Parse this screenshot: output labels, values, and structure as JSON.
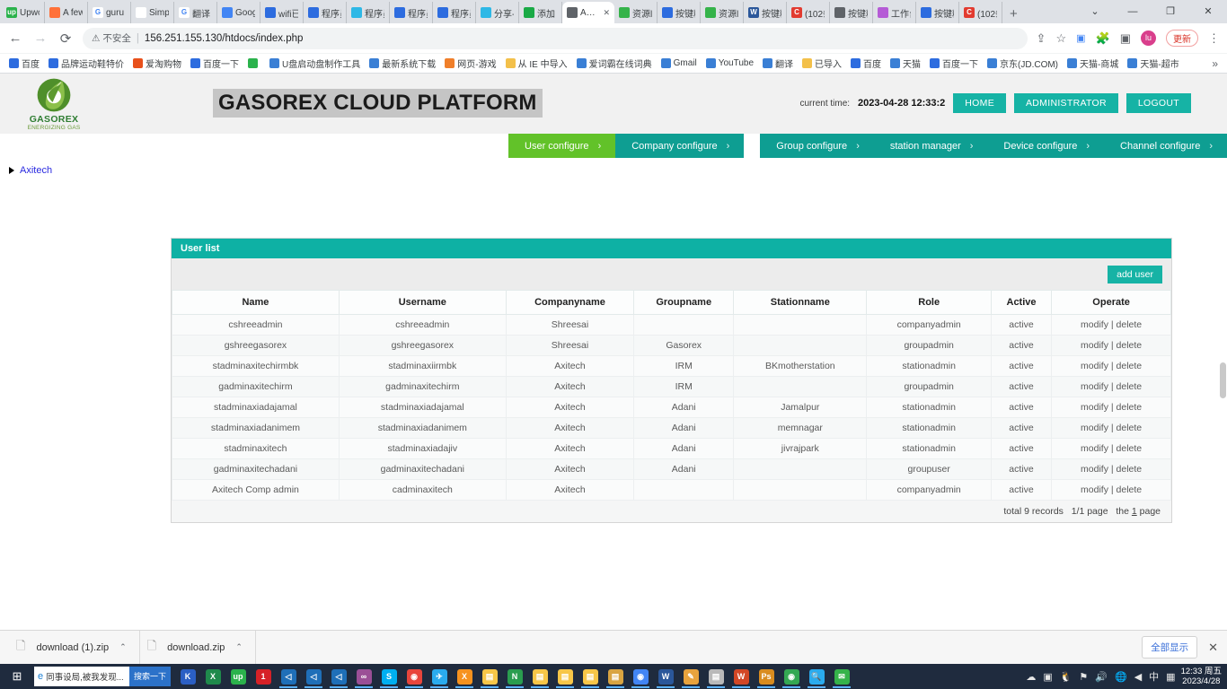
{
  "browser": {
    "tabs": [
      {
        "label": "Upwo",
        "icon": "up-icon",
        "color": "#2bb24c",
        "active": false
      },
      {
        "label": "A few",
        "icon": "firefox-icon",
        "color": "#ff7139",
        "active": false
      },
      {
        "label": "guru",
        "icon": "google-g-icon",
        "color": "#ffffff",
        "active": false
      },
      {
        "label": "Simp",
        "icon": "scissors-icon",
        "color": "#ffffff",
        "active": false
      },
      {
        "label": "翻译",
        "icon": "google-g-icon",
        "color": "#ffffff",
        "active": false
      },
      {
        "label": "Goog",
        "icon": "translate-icon",
        "color": "#4285f4",
        "active": false
      },
      {
        "label": "wifi已",
        "icon": "baidu-icon",
        "color": "#2d6cdf",
        "active": false
      },
      {
        "label": "程序员",
        "icon": "baidu-icon",
        "color": "#2d6cdf",
        "active": false
      },
      {
        "label": "程序员",
        "icon": "calendar-icon",
        "color": "#2eb8e6",
        "active": false
      },
      {
        "label": "程序员",
        "icon": "baidu-icon",
        "color": "#2d6cdf",
        "active": false
      },
      {
        "label": "程序员",
        "icon": "baidu-icon",
        "color": "#2d6cdf",
        "active": false
      },
      {
        "label": "分享-",
        "icon": "calendar-icon",
        "color": "#2eb8e6",
        "active": false
      },
      {
        "label": "添加",
        "icon": "youdao-icon",
        "color": "#1aaa46",
        "active": false
      },
      {
        "label": "A…",
        "icon": "globe-icon",
        "color": "#5f6368",
        "active": true
      },
      {
        "label": "资源l",
        "icon": "resource-icon",
        "color": "#35b34a",
        "active": false
      },
      {
        "label": "按键精",
        "icon": "baidu-icon",
        "color": "#2d6cdf",
        "active": false
      },
      {
        "label": "资源l",
        "icon": "resource-icon",
        "color": "#35b34a",
        "active": false
      },
      {
        "label": "按键精",
        "icon": "word-icon",
        "color": "#2b579a",
        "active": false
      },
      {
        "label": "(102条",
        "icon": "csdn-icon",
        "color": "#e23b30",
        "active": false
      },
      {
        "label": "按键精",
        "icon": "globe-icon",
        "color": "#5f6368",
        "active": false
      },
      {
        "label": "工作台",
        "icon": "feishu-icon",
        "color": "#b55bd6",
        "active": false
      },
      {
        "label": "按键精",
        "icon": "baidu-icon",
        "color": "#2d6cdf",
        "active": false
      },
      {
        "label": "(102条",
        "icon": "csdn-icon",
        "color": "#e23b30",
        "active": false
      }
    ],
    "new_tab_label": "+",
    "window_controls": {
      "minimize": "—",
      "maximize": "❐",
      "close": "✕",
      "expand": "⌄"
    },
    "nav": {
      "back": "←",
      "forward": "→",
      "reload": "⟳"
    },
    "omnibox": {
      "security_icon": "warning-triangle-icon",
      "security_label": "不安全",
      "url": "156.251.155.130/htdocs/index.php"
    },
    "toolbar_icons": [
      {
        "name": "translate-icon",
        "glyph": "文"
      },
      {
        "name": "extensions-puzzle-icon",
        "glyph": "🧩"
      },
      {
        "name": "sidepanel-icon",
        "glyph": "▣"
      }
    ],
    "profile_initial": "lu",
    "update_label": "更新",
    "menu_glyph": "⋮",
    "share_glyph": "⇪",
    "star_glyph": "☆",
    "bookmarks": [
      {
        "label": "百度",
        "icon": "baidu-icon",
        "color": "#2d6cdf"
      },
      {
        "label": "品牌运动鞋特价",
        "icon": "baidu-icon",
        "color": "#2d6cdf"
      },
      {
        "label": "爱淘购物",
        "icon": "taobao-icon",
        "color": "#e8501b"
      },
      {
        "label": "百度一下",
        "icon": "baidu-icon",
        "color": "#2d6cdf"
      },
      {
        "label": "",
        "icon": "up-icon",
        "color": "#2bb24c"
      },
      {
        "label": "U盘启动盘制作工具",
        "icon": "globe-icon",
        "color": "#3a7fd5"
      },
      {
        "label": "最新系统下载",
        "icon": "globe-icon",
        "color": "#3a7fd5"
      },
      {
        "label": "网页-游戏",
        "icon": "opera-icon",
        "color": "#f07f2a"
      },
      {
        "label": "从 IE 中导入",
        "icon": "folder-icon",
        "color": "#f3c04a"
      },
      {
        "label": "爱词霸在线词典",
        "icon": "globe-icon",
        "color": "#3a7fd5"
      },
      {
        "label": "Gmail",
        "icon": "globe-icon",
        "color": "#3a7fd5"
      },
      {
        "label": "YouTube",
        "icon": "globe-icon",
        "color": "#3a7fd5"
      },
      {
        "label": "翻译",
        "icon": "globe-icon",
        "color": "#3a7fd5"
      },
      {
        "label": "已导入",
        "icon": "folder-icon",
        "color": "#f3c04a"
      },
      {
        "label": "百度",
        "icon": "baidu-icon",
        "color": "#2d6cdf"
      },
      {
        "label": "天猫",
        "icon": "globe-icon",
        "color": "#3a7fd5"
      },
      {
        "label": "百度一下",
        "icon": "baidu-icon",
        "color": "#2d6cdf"
      },
      {
        "label": "京东(JD.COM)",
        "icon": "globe-icon",
        "color": "#3a7fd5"
      },
      {
        "label": "天猫-商城",
        "icon": "globe-icon",
        "color": "#3a7fd5"
      },
      {
        "label": "天猫-超市",
        "icon": "globe-icon",
        "color": "#3a7fd5"
      }
    ],
    "bookmarks_overflow": "»"
  },
  "site": {
    "logo": {
      "name": "GASOREX",
      "tagline": "ENERGIZING GAS",
      "accent": "#4a8a2c"
    },
    "title": "GASOREX CLOUD PLATFORM",
    "translate_badge": "G",
    "time_label": "current time:",
    "time_value": "2023-04-28 12:33:2",
    "buttons": [
      {
        "label": "HOME",
        "name": "home-button"
      },
      {
        "label": "ADMINISTRATOR",
        "name": "administrator-button"
      },
      {
        "label": "LOGOUT",
        "name": "logout-button"
      }
    ],
    "accent": "#16b3a5",
    "nav": [
      {
        "label": "User configure",
        "active": true,
        "chevron": "›"
      },
      {
        "label": "Company configure",
        "active": false,
        "chevron": "›"
      },
      {
        "label": "Group configure",
        "active": false,
        "chevron": "›"
      },
      {
        "label": "station manager",
        "active": false,
        "chevron": "›"
      },
      {
        "label": "Device configure",
        "active": false,
        "chevron": "›"
      },
      {
        "label": "Channel configure",
        "active": false,
        "chevron": "›"
      }
    ]
  },
  "sidebar": {
    "tree": [
      {
        "label": "Axitech",
        "arrow": "▶"
      }
    ]
  },
  "panel": {
    "title": "User list",
    "add_button": "add user",
    "columns": [
      "Name",
      "Username",
      "Companyname",
      "Groupname",
      "Stationname",
      "Role",
      "Active",
      "Operate"
    ],
    "rows": [
      {
        "name": "cshreeadmin",
        "username": "cshreeadmin",
        "company": "Shreesai",
        "group": "",
        "station": "",
        "role": "companyadmin",
        "active": "active",
        "operate": "modify | delete"
      },
      {
        "name": "gshreegasorex",
        "username": "gshreegasorex",
        "company": "Shreesai",
        "group": "Gasorex",
        "station": "",
        "role": "groupadmin",
        "active": "active",
        "operate": "modify | delete"
      },
      {
        "name": "stadminaxitechirmbk",
        "username": "stadminaxiirmbk",
        "company": "Axitech",
        "group": "IRM",
        "station": "BKmotherstation",
        "role": "stationadmin",
        "active": "active",
        "operate": "modify | delete"
      },
      {
        "name": "gadminaxitechirm",
        "username": "gadminaxitechirm",
        "company": "Axitech",
        "group": "IRM",
        "station": "",
        "role": "groupadmin",
        "active": "active",
        "operate": "modify | delete"
      },
      {
        "name": "stadminaxiadajamal",
        "username": "stadminaxiadajamal",
        "company": "Axitech",
        "group": "Adani",
        "station": "Jamalpur",
        "role": "stationadmin",
        "active": "active",
        "operate": "modify | delete"
      },
      {
        "name": "stadminaxiadanimem",
        "username": "stadminaxiadanimem",
        "company": "Axitech",
        "group": "Adani",
        "station": "memnagar",
        "role": "stationadmin",
        "active": "active",
        "operate": "modify | delete"
      },
      {
        "name": "stadminaxitech",
        "username": "stadminaxiadajiv",
        "company": "Axitech",
        "group": "Adani",
        "station": "jivrajpark",
        "role": "stationadmin",
        "active": "active",
        "operate": "modify | delete"
      },
      {
        "name": "gadminaxitechadani",
        "username": "gadminaxitechadani",
        "company": "Axitech",
        "group": "Adani",
        "station": "",
        "role": "groupuser",
        "active": "active",
        "operate": "modify | delete"
      },
      {
        "name": "Axitech Comp admin",
        "username": "cadminaxitech",
        "company": "Axitech",
        "group": "",
        "station": "",
        "role": "companyadmin",
        "active": "active",
        "operate": "modify | delete"
      }
    ],
    "footer": {
      "total_label": "total",
      "total_count": "9",
      "records_label": "records",
      "page_of": "1/1 page",
      "the_label": "the",
      "current_page": "1",
      "page_label": "page"
    }
  },
  "downloads": {
    "items": [
      {
        "filename": "download (1).zip",
        "caret": "⌃"
      },
      {
        "filename": "download.zip",
        "caret": "⌃"
      }
    ],
    "show_all": "全部显示",
    "close": "✕"
  },
  "taskbar": {
    "start_glyph": "⊞",
    "search_text": "同事设局,被我发现...",
    "search_button": "搜索一下",
    "apps": [
      {
        "name": "wps-icon",
        "glyph": "K",
        "color": "#2b5fc4",
        "open": false
      },
      {
        "name": "excel-icon",
        "glyph": "X",
        "color": "#1f8a4c",
        "open": false
      },
      {
        "name": "upwork-icon",
        "glyph": "up",
        "color": "#2bb24c",
        "open": false
      },
      {
        "name": "notify-icon",
        "glyph": "1",
        "color": "#d62127",
        "open": false
      },
      {
        "name": "vscode-icon",
        "glyph": "◁",
        "color": "#1f6fb8",
        "open": true
      },
      {
        "name": "vscode-icon",
        "glyph": "◁",
        "color": "#1f6fb8",
        "open": true
      },
      {
        "name": "vscode-icon",
        "glyph": "◁",
        "color": "#1f6fb8",
        "open": true
      },
      {
        "name": "visualstudio-icon",
        "glyph": "∞",
        "color": "#9b4f96",
        "open": true
      },
      {
        "name": "skype-icon",
        "glyph": "S",
        "color": "#00aff0",
        "open": true
      },
      {
        "name": "chrome-icon",
        "glyph": "◉",
        "color": "#e8453c",
        "open": true
      },
      {
        "name": "telegram-icon",
        "glyph": "✈",
        "color": "#2aabee",
        "open": true
      },
      {
        "name": "xampp-icon",
        "glyph": "X",
        "color": "#f6921e",
        "open": true
      },
      {
        "name": "explorer-icon",
        "glyph": "▤",
        "color": "#f7c648",
        "open": true
      },
      {
        "name": "navicat-icon",
        "glyph": "N",
        "color": "#2a9d4f",
        "open": true
      },
      {
        "name": "folder-icon",
        "glyph": "▤",
        "color": "#f7c648",
        "open": true
      },
      {
        "name": "folder-icon",
        "glyph": "▤",
        "color": "#f7c648",
        "open": true
      },
      {
        "name": "folder-icon",
        "glyph": "▤",
        "color": "#f7c648",
        "open": true
      },
      {
        "name": "folder-icon",
        "glyph": "▤",
        "color": "#d9a441",
        "open": true
      },
      {
        "name": "chrome-icon",
        "glyph": "◉",
        "color": "#4285f4",
        "open": true
      },
      {
        "name": "word-icon",
        "glyph": "W",
        "color": "#2b579a",
        "open": true
      },
      {
        "name": "editor-icon",
        "glyph": "✎",
        "color": "#e8a33d",
        "open": true
      },
      {
        "name": "notepad-icon",
        "glyph": "▤",
        "color": "#b9b9b9",
        "open": true
      },
      {
        "name": "wps-icon",
        "glyph": "W",
        "color": "#d24726",
        "open": true
      },
      {
        "name": "ps-icon",
        "glyph": "Ps",
        "color": "#d98c1f",
        "open": true
      },
      {
        "name": "chrome-icon",
        "glyph": "◉",
        "color": "#34a853",
        "open": true
      },
      {
        "name": "search-icon",
        "glyph": "🔍",
        "color": "#2aabee",
        "open": true
      },
      {
        "name": "mail-icon",
        "glyph": "✉",
        "color": "#35b34a",
        "open": true
      }
    ],
    "tray": [
      {
        "name": "cloud-icon",
        "glyph": "☁"
      },
      {
        "name": "app-blue-icon",
        "glyph": "▣"
      },
      {
        "name": "qq-icon",
        "glyph": "🐧"
      },
      {
        "name": "flag-icon",
        "glyph": "⚑"
      },
      {
        "name": "volume-icon",
        "glyph": "🔊"
      },
      {
        "name": "network-icon",
        "glyph": "🌐"
      },
      {
        "name": "sound-icon",
        "glyph": "◀"
      },
      {
        "name": "ime-icon",
        "glyph": "中"
      },
      {
        "name": "keyboard-icon",
        "glyph": "▦"
      }
    ],
    "clock_time": "12:33 周五",
    "clock_date": "2023/4/28"
  }
}
